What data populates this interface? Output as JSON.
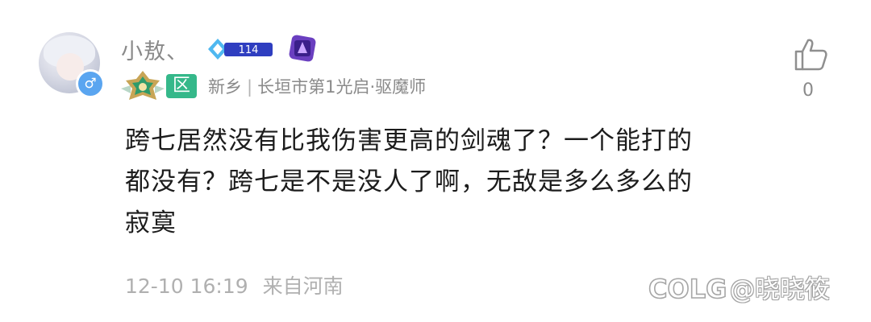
{
  "user": {
    "name": "小敖、",
    "level": "114",
    "gender_symbol": "♂",
    "zone_tag": "区",
    "location": "新乡",
    "separator": "|",
    "guild_info": "长垣市第1光启·驱魔师"
  },
  "comment": {
    "text": "跨七居然没有比我伤害更高的剑魂了？一个能打的\n都没有？跨七是不是没人了啊，无敌是多么多么的\n寂寞"
  },
  "meta": {
    "timestamp": "12-10 16:19",
    "source": "来自河南"
  },
  "like": {
    "count": "0",
    "icon": "thumbs-up-icon"
  },
  "watermark": {
    "logo_text": "COLG",
    "handle": "@晓晓筱"
  },
  "colors": {
    "zone_tag": "#35b88a",
    "gender_badge": "#5aa5f0",
    "level_badge": "#3b4fd0",
    "vip_badge": "#6a3fc0"
  }
}
